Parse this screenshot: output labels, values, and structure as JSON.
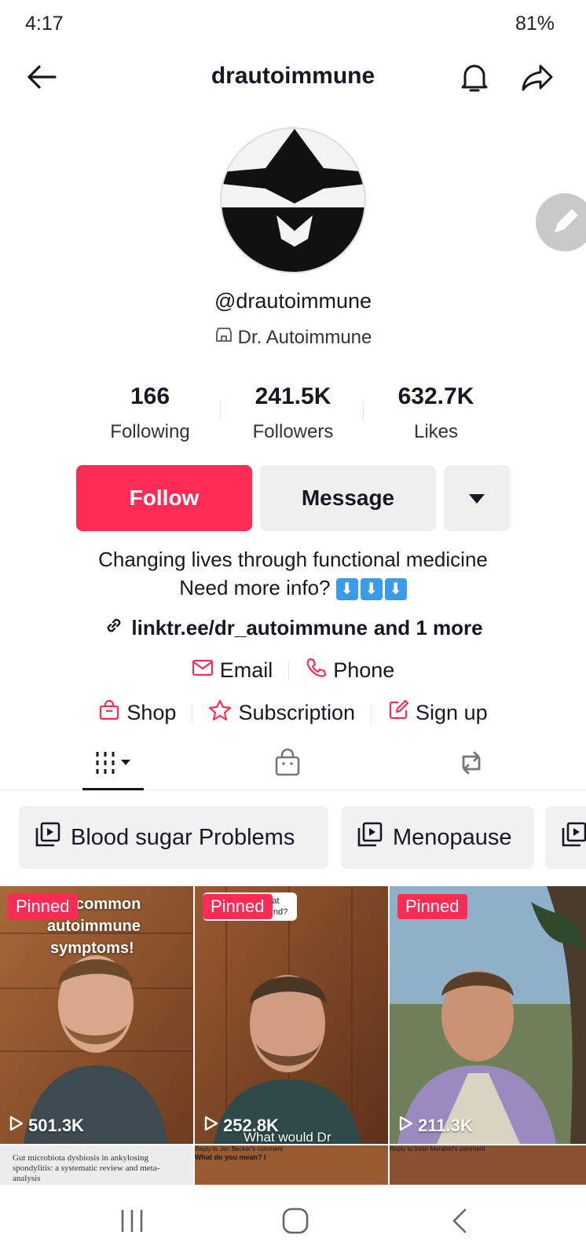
{
  "status_bar": {
    "time": "4:17",
    "battery": "81%"
  },
  "header": {
    "title": "drautoimmune",
    "icons": [
      "back-arrow-icon",
      "bell-icon",
      "share-icon"
    ]
  },
  "profile": {
    "handle": "@drautoimmune",
    "display_name": "Dr. Autoimmune",
    "stats": [
      {
        "value": "166",
        "label": "Following"
      },
      {
        "value": "241.5K",
        "label": "Followers"
      },
      {
        "value": "632.7K",
        "label": "Likes"
      }
    ],
    "buttons": {
      "follow": "Follow",
      "message": "Message"
    },
    "bio_line1": "Changing lives through functional medicine",
    "bio_line2": "Need more info?",
    "bio_emoji": [
      "⬇",
      "⬇",
      "⬇"
    ],
    "link": "linktr.ee/dr_autoimmune",
    "link_more": "and 1 more",
    "contacts": [
      "Email",
      "Phone"
    ],
    "shop_links": [
      "Shop",
      "Subscription",
      "Sign up"
    ]
  },
  "playlists": [
    "Blood sugar Problems",
    "Menopause"
  ],
  "videos": [
    {
      "pinned": "Pinned",
      "views": "501.3K",
      "overlay_line1": "common",
      "overlay_line2": "autoimmune",
      "overlay_line3": "symptoms!"
    },
    {
      "pinned": "Pinned",
      "views": "252.8K",
      "bubble": "Hashimoto's, what do you recommend?",
      "caption": "What would Dr"
    },
    {
      "pinned": "Pinned",
      "views": "211.3K"
    }
  ],
  "second_row": [
    {
      "text": "Gut microbiota dysbiosis in ankylosing spondylitis: a systematic review and meta-analysis"
    },
    {
      "reply": "Reply to Jen Becker's comment",
      "comment": "What do you mean? I"
    },
    {
      "reply": "Reply to Iman Merabet's comment"
    }
  ],
  "colors": {
    "accent": "#fe2c55",
    "button_gray": "#efefef",
    "link_blue": "#3a9be8"
  }
}
